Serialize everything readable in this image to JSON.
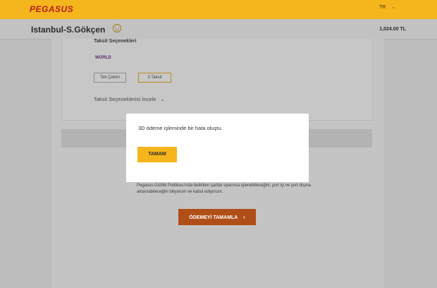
{
  "header": {
    "logo_text": "PEGASUS",
    "language": "TR",
    "language_chevron": "⌄"
  },
  "route": {
    "title": "Istanbul-S.Gökçen",
    "price": "1,024.00 TL",
    "icon": "smile-icon"
  },
  "payment": {
    "installment_title": "Taksit Seçenekleri",
    "card_brand": "WORLD",
    "options": [
      {
        "label": "Tek Çekim"
      },
      {
        "label": "3 Taksit"
      }
    ],
    "details_link": "Taksit Seçeneklerini İncele",
    "details_chevron": "⌄",
    "privacy_text": "Pegasus Gizlilik Politikası'nda belirtilen şartlar uyarınca işlenebileceğini, yurt içi ve yurt dışına aktarılabileceğini biliyorum ve kabul ediyorum.",
    "complete_button": "ÖDEMEYİ TAMAMLA",
    "complete_chevron": "›"
  },
  "modal": {
    "message": "3D ödeme işleminde bir hata oluştu.",
    "ok_button": "TAMAM"
  },
  "colors": {
    "brand_yellow": "#f5b51c",
    "brand_red": "#b51d1d",
    "button_orange": "#b04e18"
  }
}
